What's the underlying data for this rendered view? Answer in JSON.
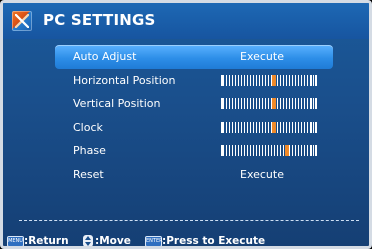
{
  "window": {
    "title": "PC SETTINGS",
    "icon": "pc-settings-icon"
  },
  "menu": {
    "items": [
      {
        "label": "Auto Adjust",
        "type": "action",
        "value": "Execute",
        "selected": true
      },
      {
        "label": "Horizontal Position",
        "type": "slider",
        "level": 0.55
      },
      {
        "label": "Vertical Position",
        "type": "slider",
        "level": 0.55
      },
      {
        "label": "Clock",
        "type": "slider",
        "level": 0.55
      },
      {
        "label": "Phase",
        "type": "slider",
        "level": 0.7
      },
      {
        "label": "Reset",
        "type": "action",
        "value": "Execute"
      }
    ]
  },
  "footer": {
    "menu_key": "MENU",
    "return_label": ":Return",
    "move_label": ":Move",
    "enter_key": "ENTER",
    "execute_label": ":Press to Execute"
  },
  "colors": {
    "background": "#1a4f8c",
    "highlight": "#2d8ee8",
    "slider_thumb": "#f08a2a",
    "text": "#ffffff"
  }
}
